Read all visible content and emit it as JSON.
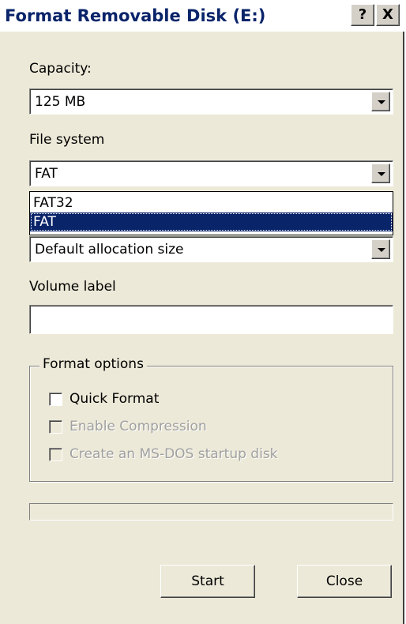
{
  "window": {
    "title": "Format Removable Disk (E:)",
    "help_button": "?",
    "close_button": "X"
  },
  "capacity": {
    "label": "Capacity:",
    "value": "125 MB"
  },
  "file_system": {
    "label": "File system",
    "value": "FAT",
    "options": [
      "FAT32",
      "FAT"
    ],
    "highlighted": "FAT"
  },
  "allocation": {
    "value": "Default allocation size"
  },
  "volume_label": {
    "label": "Volume label",
    "value": ""
  },
  "format_options": {
    "title": "Format options",
    "quick_format": "Quick Format",
    "enable_compression": "Enable Compression",
    "msdos_startup": "Create an MS-DOS startup disk"
  },
  "buttons": {
    "start": "Start",
    "close": "Close"
  }
}
